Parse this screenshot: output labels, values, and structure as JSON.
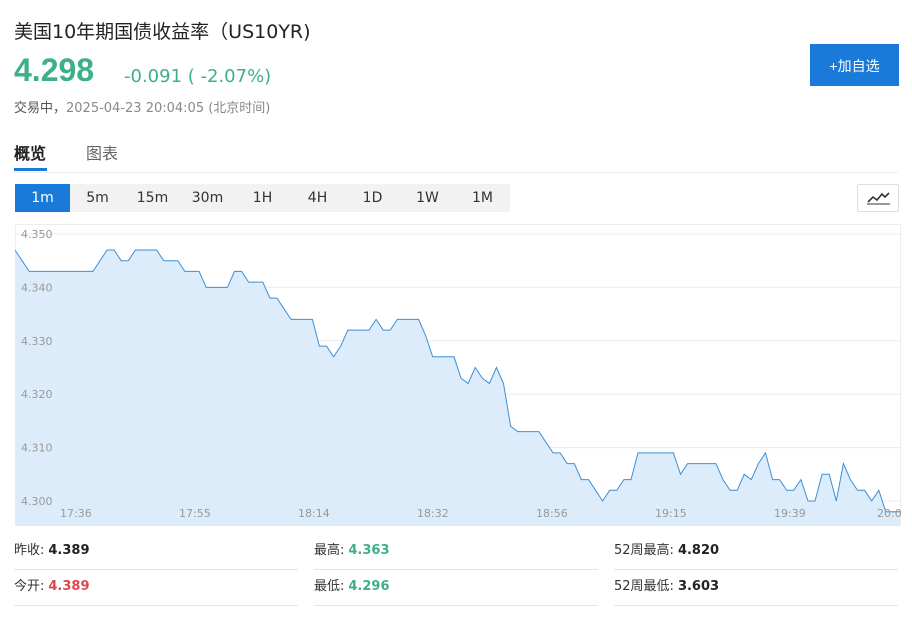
{
  "header": {
    "title": "美国10年期国债收益率（US10YR)",
    "price": "4.298",
    "change": "-0.091 ( -2.07%)",
    "status_label": "交易中，",
    "timestamp": "2025-04-23 20:04:05 (北京时间)",
    "add_button": "+加自选"
  },
  "tabs": [
    "概览",
    "图表"
  ],
  "intervals": [
    "1m",
    "5m",
    "15m",
    "30m",
    "1H",
    "4H",
    "1D",
    "1W",
    "1M"
  ],
  "active_interval": "1m",
  "chart_type_icon": "line-chart-icon",
  "colors": {
    "up_green": "#3db088",
    "down_red": "#e0474c",
    "accent_blue": "#1a7ad9",
    "fill": "#dcecfb",
    "line": "#3d8fd6"
  },
  "chart_data": {
    "type": "area",
    "x_ticks": [
      "17:36",
      "17:55",
      "18:14",
      "18:32",
      "18:56",
      "19:15",
      "19:39",
      "20:0"
    ],
    "y_ticks": [
      "4.350",
      "4.340",
      "4.330",
      "4.320",
      "4.310",
      "4.300"
    ],
    "ylim": [
      4.298,
      4.352
    ],
    "grid": true,
    "values": [
      4.347,
      4.345,
      4.343,
      4.343,
      4.343,
      4.343,
      4.343,
      4.343,
      4.343,
      4.343,
      4.343,
      4.343,
      4.345,
      4.347,
      4.347,
      4.345,
      4.345,
      4.347,
      4.347,
      4.347,
      4.347,
      4.345,
      4.345,
      4.345,
      4.343,
      4.343,
      4.343,
      4.34,
      4.34,
      4.34,
      4.34,
      4.343,
      4.343,
      4.341,
      4.341,
      4.341,
      4.338,
      4.338,
      4.336,
      4.334,
      4.334,
      4.334,
      4.334,
      4.329,
      4.329,
      4.327,
      4.329,
      4.332,
      4.332,
      4.332,
      4.332,
      4.334,
      4.332,
      4.332,
      4.334,
      4.334,
      4.334,
      4.334,
      4.331,
      4.327,
      4.327,
      4.327,
      4.327,
      4.323,
      4.322,
      4.325,
      4.323,
      4.322,
      4.325,
      4.322,
      4.314,
      4.313,
      4.313,
      4.313,
      4.313,
      4.311,
      4.309,
      4.309,
      4.307,
      4.307,
      4.304,
      4.304,
      4.302,
      4.3,
      4.302,
      4.302,
      4.304,
      4.304,
      4.309,
      4.309,
      4.309,
      4.309,
      4.309,
      4.309,
      4.305,
      4.307,
      4.307,
      4.307,
      4.307,
      4.307,
      4.304,
      4.302,
      4.302,
      4.305,
      4.304,
      4.307,
      4.309,
      4.304,
      4.304,
      4.302,
      4.302,
      4.304,
      4.3,
      4.3,
      4.305,
      4.305,
      4.3,
      4.307,
      4.304,
      4.302,
      4.302,
      4.3,
      4.302,
      4.298,
      4.298,
      4.298
    ]
  },
  "stats": [
    {
      "label": "昨收:",
      "value": "4.389",
      "tone": ""
    },
    {
      "label": "最高:",
      "value": "4.363",
      "tone": "green"
    },
    {
      "label": "52周最高:",
      "value": "4.820",
      "tone": ""
    },
    {
      "label": "今开:",
      "value": "4.389",
      "tone": "red"
    },
    {
      "label": "最低:",
      "value": "4.296",
      "tone": "green"
    },
    {
      "label": "52周最低:",
      "value": "3.603",
      "tone": ""
    }
  ]
}
